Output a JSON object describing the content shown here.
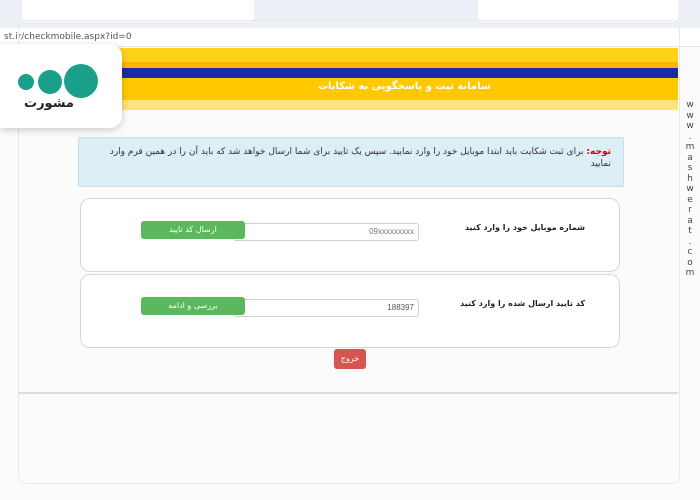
{
  "browser": {
    "url": "st.ir/checkmobile.aspx?id=0"
  },
  "banner": {
    "title": "سامانه ثبت و پاسخگویی به شکایات"
  },
  "logo": {
    "text": "مشورت"
  },
  "side_url": "www.mashwerat.com",
  "notice": {
    "label": "توجه:",
    "text": " برای ثبت شکایت باید ابتدا موبایل خود را وارد نمایید. سپس یک تایید برای شما ارسال خواهد شد که باید آن را در همین فرم وارد نمایید"
  },
  "mobile_section": {
    "label": "شماره موبایل خود را وارد کنید",
    "placeholder": "09xxxxxxxxx",
    "value": "",
    "button": "ارسال کد تایید"
  },
  "code_section": {
    "label": "کد تایید ارسال شده را وارد کنید",
    "value": "188397",
    "button": "بررسی و ادامه"
  },
  "exit_button": "خروج",
  "colors": {
    "stripe_yellow": "#ffd21a",
    "stripe_blue": "#1a2aa6",
    "button_green": "#5cb85c",
    "button_red": "#d9534f",
    "notice_bg": "#dceef6",
    "logo_green": "#1aa08a"
  }
}
